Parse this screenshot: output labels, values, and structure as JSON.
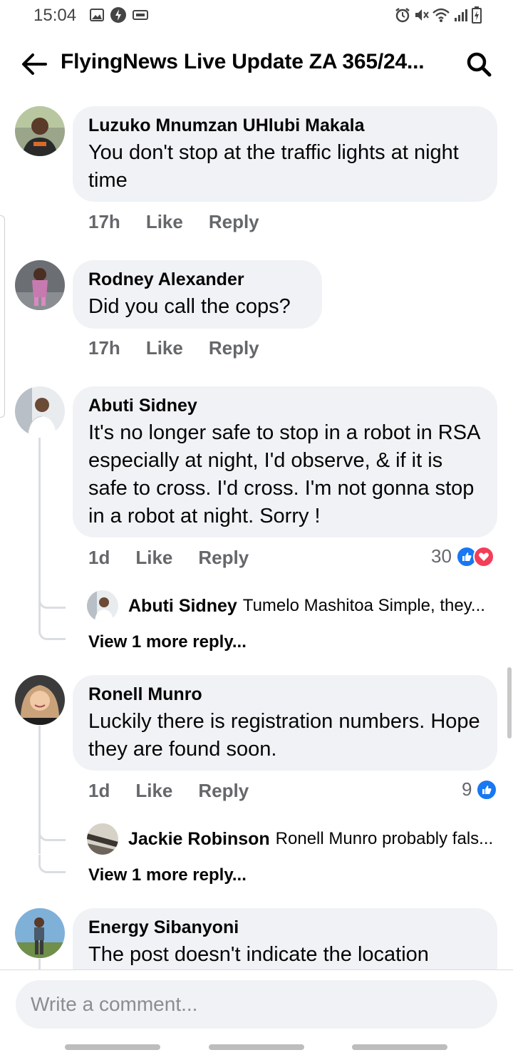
{
  "status_bar": {
    "time": "15:04"
  },
  "header": {
    "title": "FlyingNews Live Update ZA 365/24..."
  },
  "comments": [
    {
      "name": "Luzuko Mnumzan UHlubi Makala",
      "text": "You don't stop at the traffic lights at night time",
      "time": "17h",
      "like": "Like",
      "reply": "Reply"
    },
    {
      "name": "Rodney Alexander",
      "text": "Did you call the cops?",
      "time": "17h",
      "like": "Like",
      "reply": "Reply"
    },
    {
      "name": "Abuti Sidney",
      "text": "It's no longer safe to stop in a robot in RSA especially at night, I'd observe, & if it is safe to cross. I'd cross. I'm not gonna stop in a robot at night. Sorry !",
      "time": "1d",
      "like": "Like",
      "reply": "Reply",
      "reaction_count": "30",
      "reactions": [
        "like",
        "love"
      ],
      "reply_preview": {
        "name": "Abuti Sidney",
        "text": "Tumelo Mashitoa Simple, they..."
      },
      "view_more": "View 1 more reply..."
    },
    {
      "name": "Ronell Munro",
      "text": "Luckily there is registration numbers. Hope they are found soon.",
      "time": "1d",
      "like": "Like",
      "reply": "Reply",
      "reaction_count": "9",
      "reactions": [
        "like"
      ],
      "reply_preview": {
        "name": "Jackie Robinson",
        "text": "Ronell Munro probably fals..."
      },
      "view_more": "View 1 more reply..."
    },
    {
      "name": "Energy Sibanyoni",
      "text": "The post doesn't  indicate the location"
    }
  ],
  "composer": {
    "placeholder": "Write a comment..."
  },
  "colors": {
    "bubble": "#f0f2f5",
    "like_blue": "#1877f2",
    "love_red": "#f33e58",
    "meta_gray": "#65676b"
  }
}
